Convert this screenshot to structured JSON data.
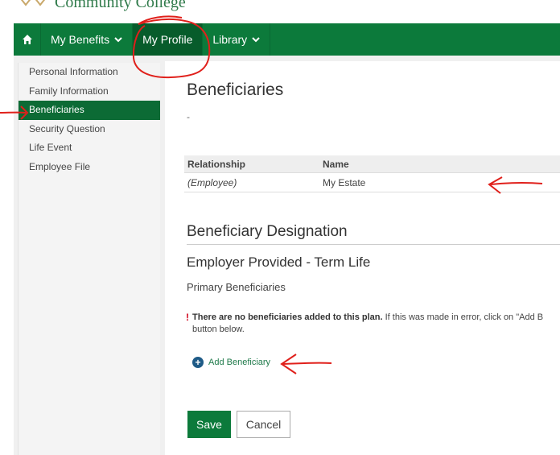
{
  "header": {
    "logo_text": "Community College"
  },
  "nav": {
    "home_icon": "home-icon",
    "items": [
      {
        "label": "My Benefits"
      },
      {
        "label": "My Profile"
      },
      {
        "label": "Library"
      }
    ]
  },
  "sidebar": {
    "items": [
      {
        "label": "Personal Information"
      },
      {
        "label": "Family Information"
      },
      {
        "label": "Beneficiaries"
      },
      {
        "label": "Security Question"
      },
      {
        "label": "Life Event"
      },
      {
        "label": "Employee File"
      }
    ]
  },
  "main": {
    "title": "Beneficiaries",
    "subtitle": "-",
    "table": {
      "headers": [
        "Relationship",
        "Name"
      ],
      "rows": [
        {
          "relationship": "(Employee)",
          "name": "My Estate"
        }
      ]
    },
    "designation_title": "Beneficiary Designation",
    "plan_title": "Employer Provided - Term Life",
    "primary_label": "Primary Beneficiaries",
    "notice_bold": "There are no beneficiaries added to this plan.",
    "notice_rest": " If this was made in error, click on \"Add B",
    "notice_line2": "button below.",
    "add_label": "Add Beneficiary"
  },
  "buttons": {
    "save": "Save",
    "cancel": "Cancel"
  },
  "colors": {
    "brand_green": "#0c7a3b",
    "annotation_red": "#e0201b"
  }
}
